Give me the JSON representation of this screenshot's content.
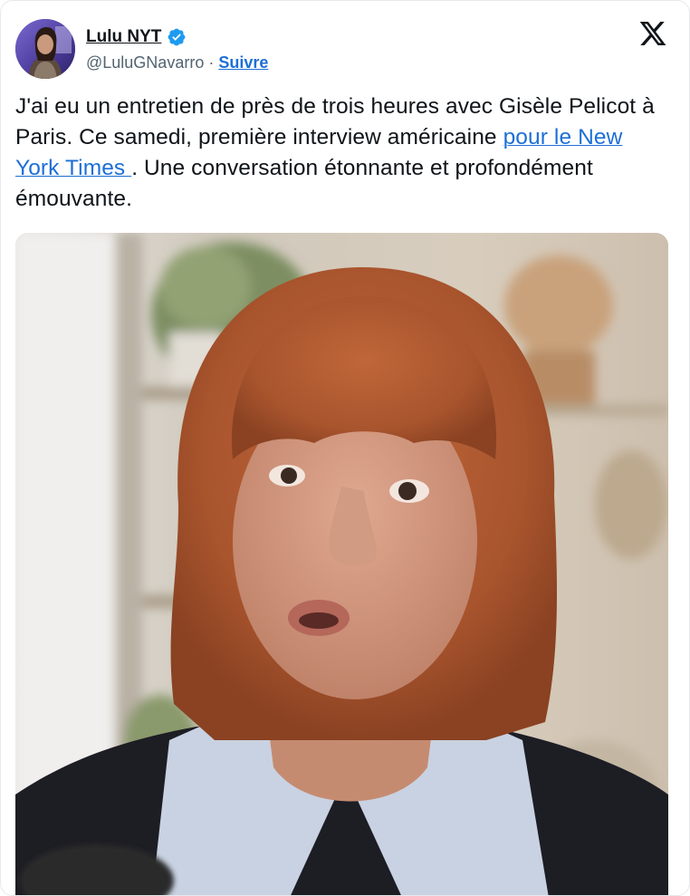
{
  "author": {
    "display_name": "Lulu NYT",
    "handle": "@LuluGNavarro",
    "separator": "·",
    "follow_label": "Suivre",
    "verified_icon": "verified-badge-icon",
    "avatar_icon": "profile-avatar"
  },
  "platform": {
    "logo_icon": "x-logo-icon"
  },
  "tweet": {
    "text_part1": "J'ai eu un entretien de près de trois heures avec Gisèle Pelicot à Paris. Ce samedi, première interview américaine ",
    "link_text": "pour le New York Times ",
    "text_part2": ". Une conversation étonnante et profondément émouvante."
  },
  "media": {
    "type": "video-still",
    "content": "portrait-photo"
  },
  "colors": {
    "link": "#1d6fd6",
    "verified": "#1d9bf0",
    "text": "#0f1419",
    "secondary": "#536471"
  }
}
